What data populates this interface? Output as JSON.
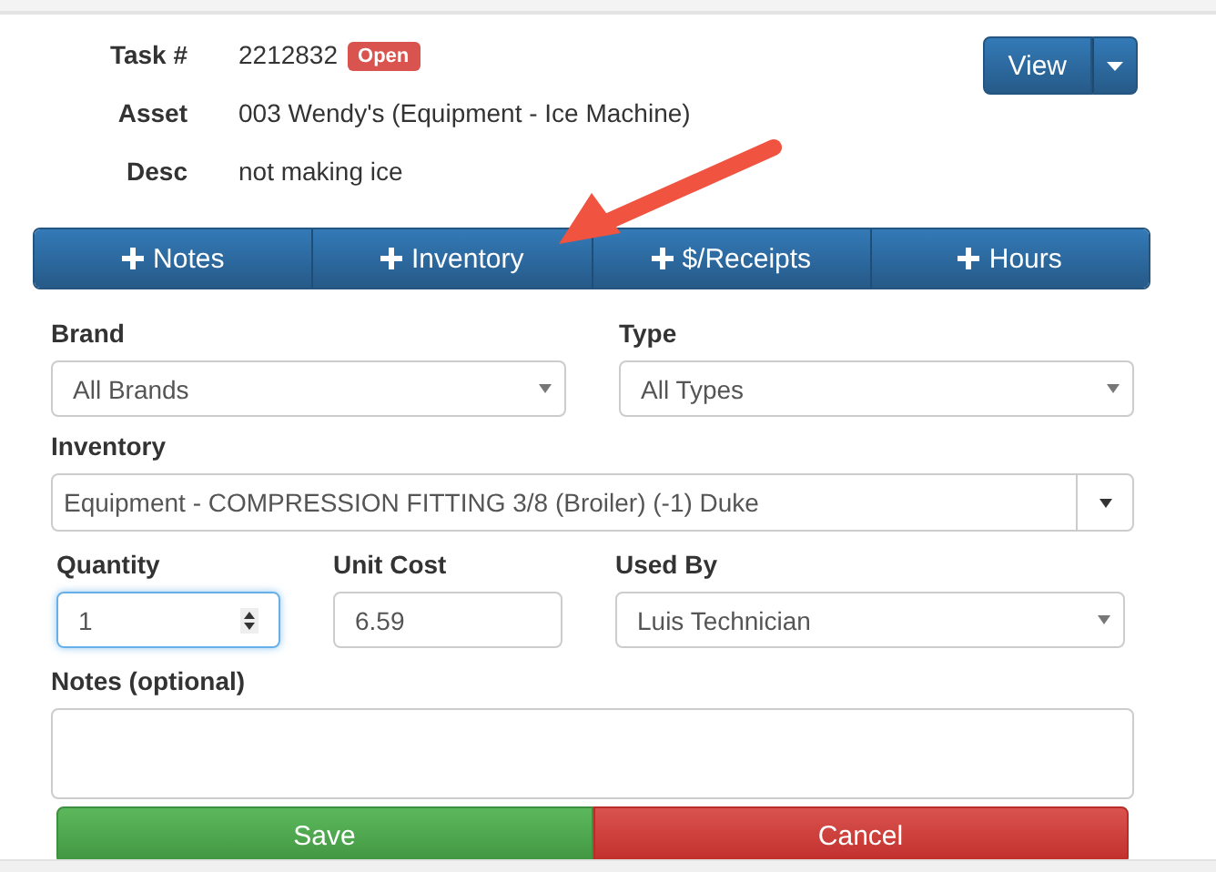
{
  "task": {
    "fields": [
      {
        "label": "Task #",
        "value": "2212832",
        "badge": "Open"
      },
      {
        "label": "Asset",
        "value": "003 Wendy's (Equipment - Ice Machine)"
      },
      {
        "label": "Desc",
        "value": "not making ice"
      }
    ],
    "view_button": {
      "label": "View"
    }
  },
  "tabs": [
    {
      "label": "Notes"
    },
    {
      "label": "Inventory"
    },
    {
      "label": "$/Receipts"
    },
    {
      "label": "Hours"
    }
  ],
  "form": {
    "brand": {
      "label": "Brand",
      "value": "All Brands"
    },
    "type": {
      "label": "Type",
      "value": "All Types"
    },
    "inventory": {
      "label": "Inventory",
      "value": "Equipment - COMPRESSION FITTING 3/8 (Broiler) (-1) Duke"
    },
    "quantity": {
      "label": "Quantity",
      "value": "1"
    },
    "unit_cost": {
      "label": "Unit Cost",
      "value": "6.59"
    },
    "used_by": {
      "label": "Used By",
      "value": "Luis Technician"
    },
    "notes": {
      "label": "Notes (optional)"
    }
  },
  "buttons": [
    {
      "label": "Save",
      "kind": "save"
    },
    {
      "label": "Cancel",
      "kind": "cancel"
    }
  ]
}
